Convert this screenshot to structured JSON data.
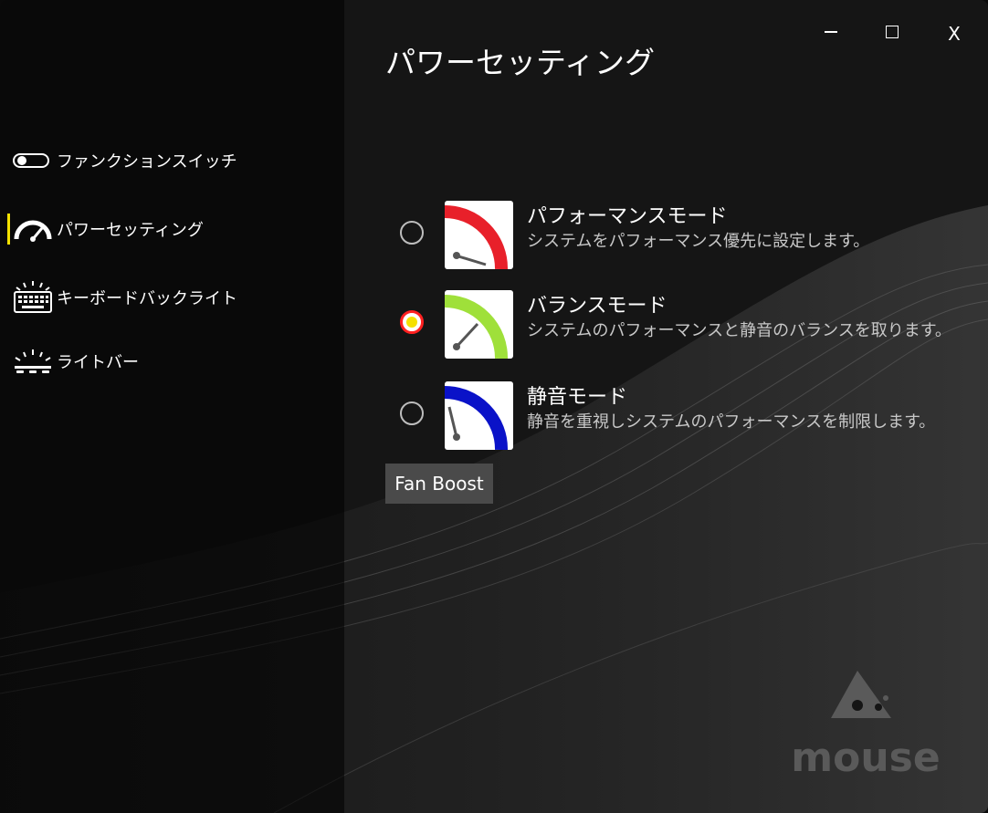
{
  "window": {
    "title": "パワーセッティング",
    "controls": {
      "minimize": "minimize",
      "maximize": "maximize",
      "close": "X"
    }
  },
  "sidebar": {
    "items": [
      {
        "label": "ファンクションスイッチ",
        "icon": "toggle-switch-icon",
        "active": false
      },
      {
        "label": "パワーセッティング",
        "icon": "speedometer-icon",
        "active": true
      },
      {
        "label": "キーボードバックライト",
        "icon": "keyboard-backlight-icon",
        "active": false
      },
      {
        "label": "ライトバー",
        "icon": "light-bar-icon",
        "active": false
      }
    ]
  },
  "modes": [
    {
      "title": "パフォーマンスモード",
      "description": "システムをパフォーマンス優先に設定します。",
      "icon": "gauge-red-icon",
      "color": "#e8202a",
      "selected": false
    },
    {
      "title": "バランスモード",
      "description": "システムのパフォーマンスと静音のバランスを取ります。",
      "icon": "gauge-green-icon",
      "color": "#9fe03a",
      "selected": true
    },
    {
      "title": "静音モード",
      "description": "静音を重視しシステムのパフォーマンスを制限します。",
      "icon": "gauge-blue-icon",
      "color": "#0a12c8",
      "selected": false
    }
  ],
  "fan_boost": {
    "label": "Fan Boost"
  },
  "brand": {
    "logo_text": "mouse",
    "accent": "#f5e200"
  }
}
